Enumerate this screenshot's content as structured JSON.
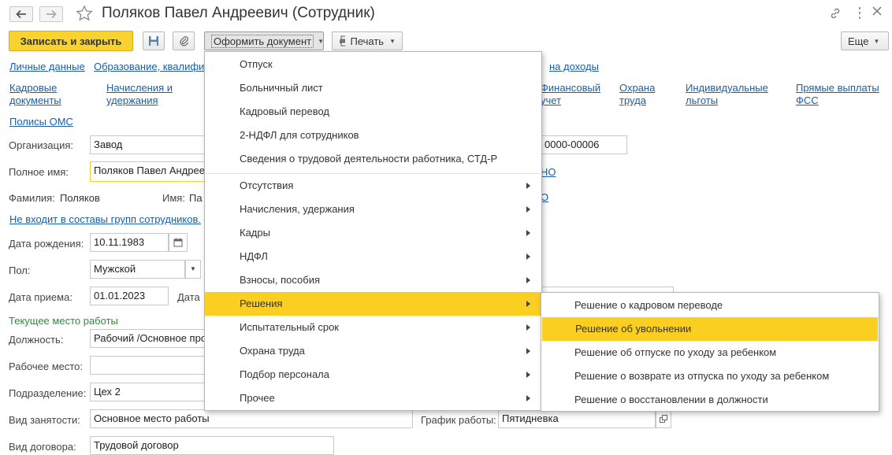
{
  "window": {
    "title": "Поляков Павел Андреевич (Сотрудник)"
  },
  "toolbar": {
    "save_close": "Записать и закрыть",
    "create_document": "Оформить документ",
    "print": "Печать",
    "more": "Еще"
  },
  "links": {
    "personal": "Личные данные",
    "education": "Образование, квалифик",
    "income_tax": "на доходы",
    "hr_docs_1": "Кадровые",
    "hr_docs_2": "документы",
    "accruals_1": "Начисления и",
    "accruals_2": "удержания",
    "fin_1": "Финансовый",
    "fin_2": "учет",
    "labor_1": "Охрана",
    "labor_2": "труда",
    "benefits_1": "Индивидуальные",
    "benefits_2": "льготы",
    "fss_1": "Прямые выплаты",
    "fss_2": "ФСС",
    "oms": "Полисы ОМС",
    "groups": "Не входит в составы групп сотрудников.",
    "partial_1": "НО",
    "partial_2": "О"
  },
  "form": {
    "org_label": "Организация:",
    "org_value": "Завод",
    "code_value": "0000-00006",
    "fullname_label": "Полное имя:",
    "fullname_value": "Поляков Павел Андрее",
    "surname_label": "Фамилия:",
    "surname_value": "Поляков",
    "name_label": "Имя:",
    "name_value": "Па",
    "birth_label": "Дата рождения:",
    "birth_value": "10.11.1983",
    "gender_label": "Пол:",
    "gender_value": "Мужской",
    "hire_label": "Дата приема:",
    "hire_value": "01.01.2023",
    "date_partial": "Дата",
    "workplace_section": "Текущее место работы",
    "position_label": "Должность:",
    "position_value": "Рабочий /Основное про",
    "workspot_label": "Рабочее место:",
    "workspot_value": "",
    "dept_label": "Подразделение:",
    "dept_value": "Цех 2",
    "employment_label": "Вид занятости:",
    "employment_value": "Основное место работы",
    "schedule_label": "График работы:",
    "schedule_value": "Пятидневка",
    "contract_label": "Вид договора:",
    "contract_value": "Трудовой договор"
  },
  "menu": {
    "items": [
      {
        "label": "Отпуск",
        "submenu": false
      },
      {
        "label": "Больничный лист",
        "submenu": false
      },
      {
        "label": "Кадровый перевод",
        "submenu": false
      },
      {
        "label": "2-НДФЛ для сотрудников",
        "submenu": false
      },
      {
        "label": "Сведения о трудовой деятельности работника, СТД-Р",
        "submenu": false
      },
      {
        "label": "Отсутствия",
        "submenu": true
      },
      {
        "label": "Начисления, удержания",
        "submenu": true
      },
      {
        "label": "Кадры",
        "submenu": true
      },
      {
        "label": "НДФЛ",
        "submenu": true
      },
      {
        "label": "Взносы, пособия",
        "submenu": true
      },
      {
        "label": "Решения",
        "submenu": true,
        "highlighted": true
      },
      {
        "label": "Испытательный срок",
        "submenu": true
      },
      {
        "label": "Охрана труда",
        "submenu": true
      },
      {
        "label": "Подбор персонала",
        "submenu": true
      },
      {
        "label": "Прочее",
        "submenu": true
      }
    ]
  },
  "submenu": {
    "items": [
      {
        "label": "Решение о кадровом переводе"
      },
      {
        "label": "Решение об увольнении",
        "highlighted": true
      },
      {
        "label": "Решение об отпуске по уходу за ребенком"
      },
      {
        "label": "Решение о возврате из отпуска по уходу за ребенком"
      },
      {
        "label": "Решение о восстановлении в должности"
      }
    ]
  },
  "colors": {
    "accent_yellow": "#fbce22",
    "link_blue": "#1a5ea8",
    "section_green": "#2e8b3a"
  }
}
